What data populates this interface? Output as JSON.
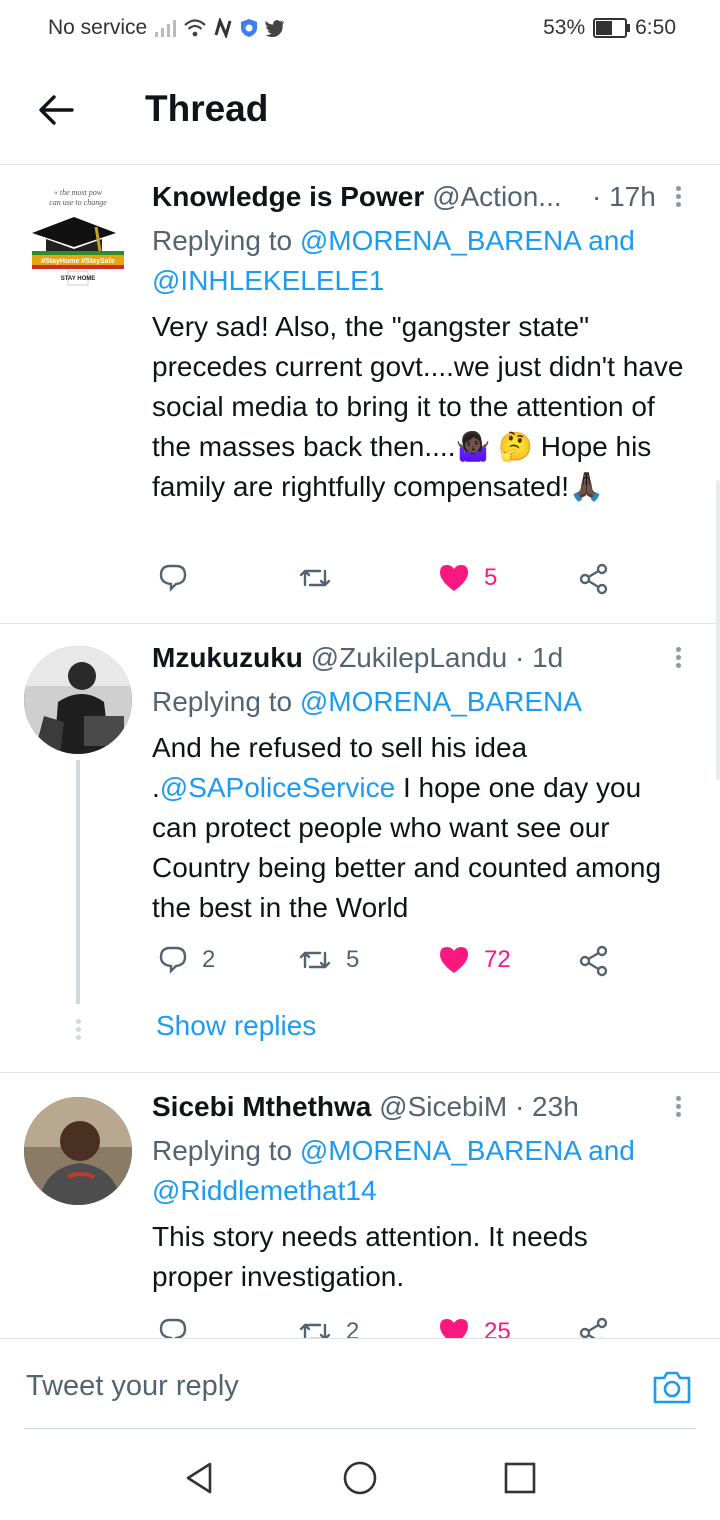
{
  "status_bar": {
    "carrier": "No service",
    "battery": "53%",
    "battery_level": 0.53,
    "time": "6:50"
  },
  "header": {
    "title": "Thread"
  },
  "tweets": [
    {
      "name": "Knowledge is Power",
      "handle": "@Action...",
      "time": "· 17h",
      "replying_prefix": "Replying to ",
      "mentions": [
        "@MORENA_BARENA",
        "@INHLEKELELE1"
      ],
      "mention_joiner": " and ",
      "text": "Very sad! Also, the \"gangster state\" precedes current govt....we just didn't have social media to bring it to the attention of the masses back then....🤷🏿‍♀️ 🤔 Hope his family are rightfully compensated!🙏🏿",
      "replies": "",
      "retweets": "",
      "likes": "5",
      "liked": true,
      "avatar_text": [
        "the most pow",
        "can use to change",
        "#StayHome #StaySafe",
        "STAY HOME"
      ]
    },
    {
      "name": "Mzukuzuku",
      "handle": "@ZukilepLandu",
      "time": "· 1d",
      "replying_prefix": "Replying to ",
      "mentions": [
        "@MORENA_BARENA"
      ],
      "text_before": "And he refused to sell his idea .",
      "text_mention": "@SAPoliceService",
      "text_after": " I hope one day you can protect people who want see our Country being better and counted among the best in the World",
      "replies": "2",
      "retweets": "5",
      "likes": "72",
      "liked": true,
      "show_replies": "Show replies"
    },
    {
      "name": "Sicebi Mthethwa",
      "handle": "@SicebiM",
      "time": "· 23h",
      "replying_prefix": "Replying to ",
      "mentions": [
        "@MORENA_BARENA",
        "@Riddlemethat14"
      ],
      "mention_joiner": " and ",
      "text": "This story needs attention. It needs proper investigation.",
      "replies": "",
      "retweets": "2",
      "likes": "25",
      "liked": true
    }
  ],
  "reply_bar": {
    "placeholder": "Tweet your reply"
  },
  "colors": {
    "accent": "#1d9bf0",
    "like": "#f91880",
    "secondary_text": "#536471",
    "divider": "#e1e4e6"
  },
  "icons": [
    "back-arrow-icon",
    "more-vertical-icon",
    "reply-icon",
    "retweet-icon",
    "heart-icon",
    "share-icon",
    "camera-icon",
    "nav-back-icon",
    "nav-home-icon",
    "nav-recents-icon"
  ]
}
